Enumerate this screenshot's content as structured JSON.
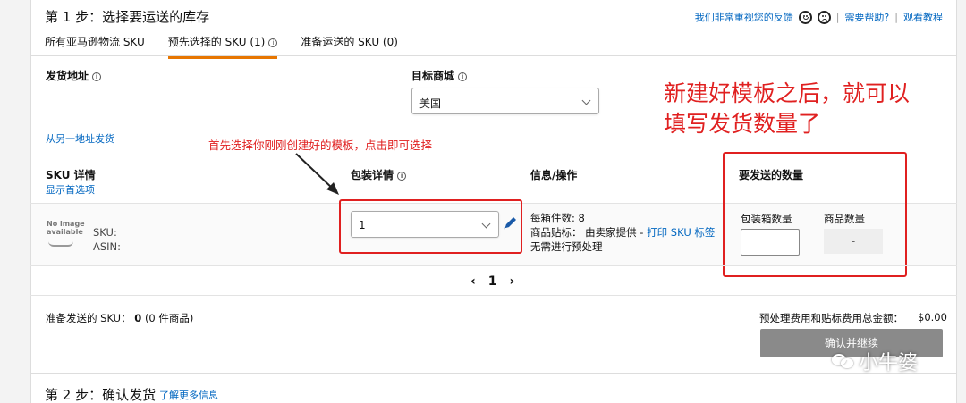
{
  "step1": {
    "title": "第 1 步：选择要运送的库存",
    "links": {
      "feedback": "我们非常重视您的反馈",
      "help": "需要帮助?",
      "tutorial": "观看教程"
    },
    "separator": "|",
    "tabs": [
      {
        "label": "所有亚马逊物流 SKU"
      },
      {
        "label": "预先选择的 SKU (1)"
      },
      {
        "label": "准备运送的 SKU (0)"
      }
    ],
    "ship_from_label": "发货地址",
    "ship_from_other": "从另一地址发货",
    "marketplace_label": "目标商城",
    "marketplace_value": "美国",
    "columns": {
      "sku_details": "SKU 详情",
      "show_preferences": "显示首选项",
      "packing_details": "包装详情",
      "info_actions": "信息/操作",
      "qty_to_send": "要发送的数量"
    },
    "item": {
      "no_image": "No image available",
      "sku_label": "SKU:",
      "asin_label": "ASIN:",
      "packing_value": "1",
      "units_per_box": "每箱件数: 8",
      "labeling_prefix": "商品贴标：",
      "labeling_value": "由卖家提供 -",
      "print_label": "打印 SKU 标签",
      "prep": "无需进行预处理",
      "box_qty_label": "包装箱数量",
      "unit_qty_label": "商品数量",
      "unit_qty_value": "-"
    },
    "pagination": {
      "prev": "‹",
      "page": "1",
      "next": "›"
    },
    "footer": {
      "ready_label": "准备发送的 SKU：",
      "ready_count": "0",
      "ready_units": "(0 件商品)",
      "fee_label": "预处理费用和贴标费用总金额：",
      "fee_value": "$0.00",
      "confirm": "确认并继续"
    }
  },
  "annotations": {
    "select_template": "首先选择你刚刚创建好的模板，点击即可选择",
    "big_note_line1": "新建好模板之后，就可以",
    "big_note_line2": "填写发货数量了"
  },
  "step2": {
    "title": "第 2 步：确认发货",
    "link": "了解更多信息"
  },
  "watermark": "小牛婆",
  "colors": {
    "accent_orange": "#e77600",
    "link_blue": "#0066c0",
    "annotation_red": "#e02020",
    "button_grey": "#8a8a8a"
  }
}
